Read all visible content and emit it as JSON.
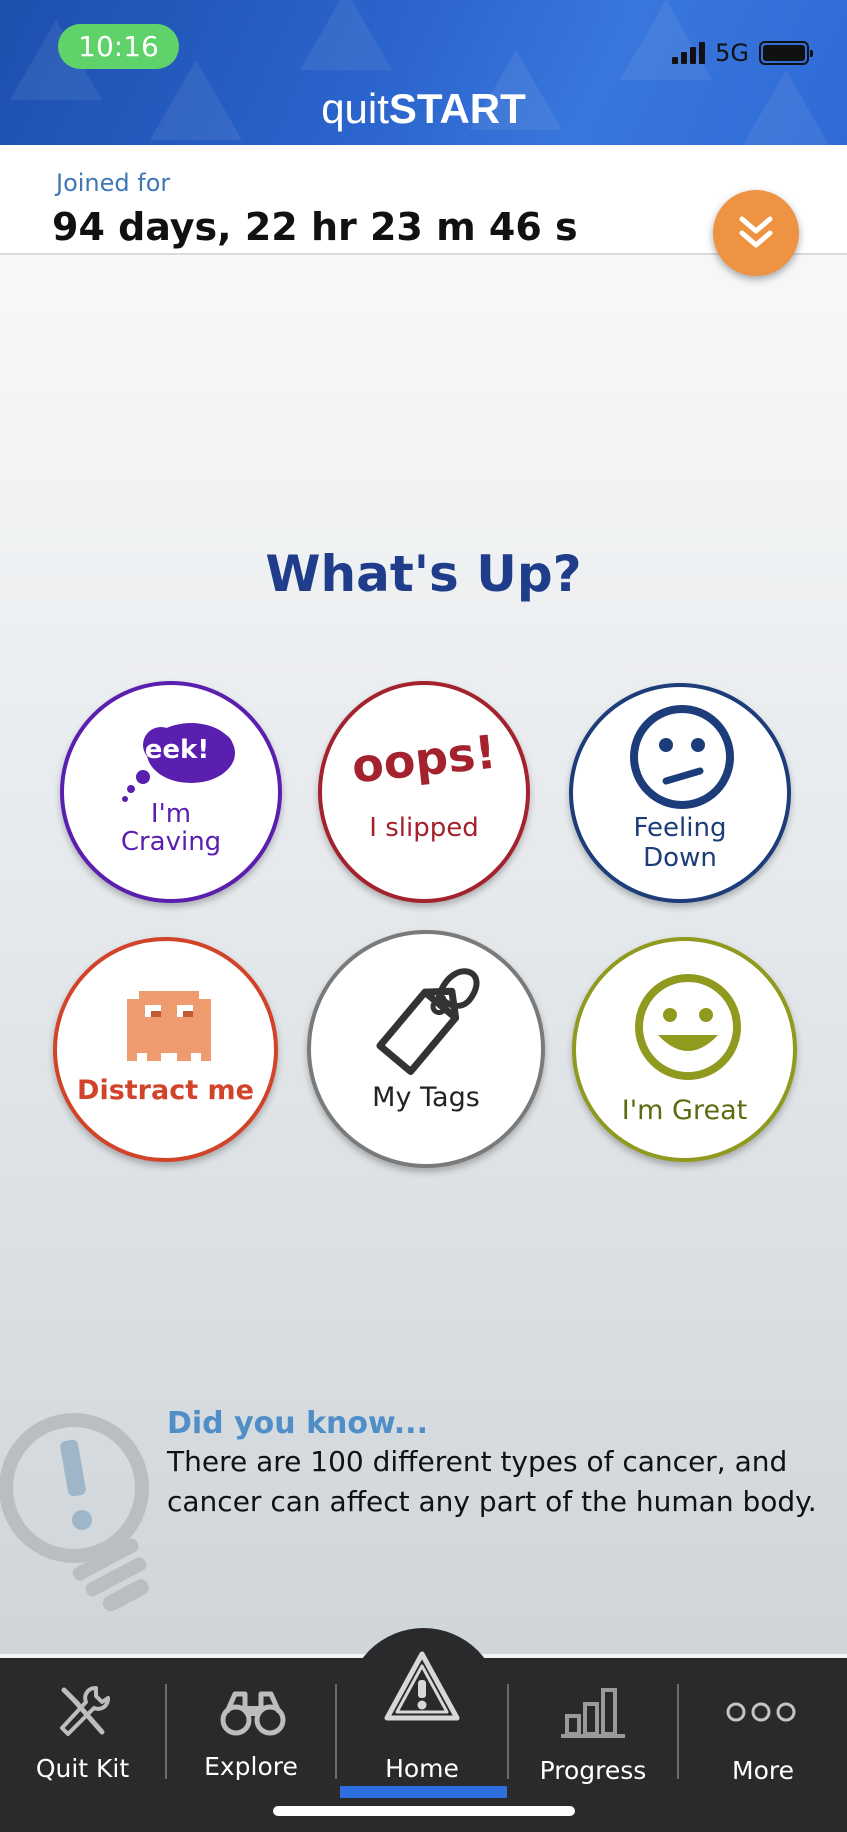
{
  "status_bar": {
    "time": "10:16",
    "network": "5G"
  },
  "app": {
    "title_light": "quit",
    "title_bold": "START"
  },
  "joined": {
    "label": "Joined for",
    "duration": "94 days, 22 hr 23 m 46 s"
  },
  "heading": "What's Up?",
  "moods": [
    {
      "badge": "eek!",
      "label_line1": "I'm",
      "label_line2": "Craving",
      "color": "#5b1fb0"
    },
    {
      "badge": "oops!",
      "label_line1": "I slipped",
      "color": "#a3222d"
    },
    {
      "label_line1": "Feeling",
      "label_line2": "Down",
      "color": "#1c3d7a"
    },
    {
      "label_line1": "Distract me",
      "color": "#d2442a"
    },
    {
      "label_line1": "My Tags",
      "color": "#6b6b6b"
    },
    {
      "label_line1": "I'm Great",
      "color": "#8f9a1e"
    }
  ],
  "tip": {
    "title": "Did you know...",
    "text": "There are 100 different types of cancer, and cancer can affect any part of the human body."
  },
  "tabs": [
    {
      "label": "Quit Kit",
      "icon": "tools-icon"
    },
    {
      "label": "Explore",
      "icon": "binoculars-icon"
    },
    {
      "label": "Home",
      "icon": "warning-triangle-icon",
      "active": true
    },
    {
      "label": "Progress",
      "icon": "bar-chart-icon"
    },
    {
      "label": "More",
      "icon": "more-dots-icon"
    }
  ],
  "colors": {
    "header": "#2b64cc",
    "accent_orange": "#ee9341",
    "heading": "#1f3d8a",
    "tab_active": "#2e6fe0"
  }
}
